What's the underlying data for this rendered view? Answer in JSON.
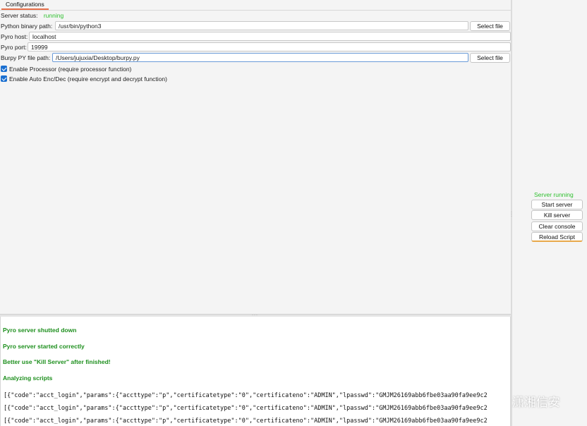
{
  "tabs": [
    {
      "label": "Configurations"
    }
  ],
  "config": {
    "server_status_label": "Server status:",
    "server_status_value": "running",
    "python_path_label": "Python binary path:",
    "python_path_value": "/usr/bin/python3",
    "pyro_host_label": "Pyro host:",
    "pyro_host_value": "localhost",
    "pyro_port_label": "Pyro port:",
    "pyro_port_value": "19999",
    "burpy_path_label": "Burpy PY file path:",
    "burpy_path_value": "/Users/jujuxia/Desktop/burpy.py",
    "select_file_label": "Select file",
    "enable_processor_label": "Enable Processor (require processor function)",
    "enable_processor_checked": true,
    "enable_autoenc_label": "Enable Auto Enc/Dec (require encrypt and decrypt function)",
    "enable_autoenc_checked": true
  },
  "right_panel": {
    "status": "Server running",
    "status_color": "#2fc02f",
    "start_server": "Start server",
    "kill_server": "Kill server",
    "clear_console": "Clear console",
    "reload_script": "Reload Script"
  },
  "console": {
    "messages": [
      "Pyro server shutted down",
      "Pyro server started correctly",
      "Better use \"Kill Server\" after finished!",
      "Analyzing scripts"
    ],
    "json_lines": [
      "[{\"code\":\"acct_login\",\"params\":{\"accttype\":\"p\",\"certificatetype\":\"0\",\"certificateno\":\"ADMIN\",\"lpasswd\":\"GMJM26169abb6fbe03aa90fa9ee9c2",
      "[{\"code\":\"acct_login\",\"params\":{\"accttype\":\"p\",\"certificatetype\":\"0\",\"certificateno\":\"ADMIN\",\"lpasswd\":\"GMJM26169abb6fbe03aa90fa9ee9c2",
      "[{\"code\":\"acct_login\",\"params\":{\"accttype\":\"p\",\"certificatetype\":\"0\",\"certificateno\":\"ADMIN\",\"lpasswd\":\"GMJM26169abb6fbe03aa90fa9ee9c2"
    ]
  },
  "watermark": {
    "text": "潇湘信安",
    "icon": "wechat-icon"
  },
  "colors": {
    "accent_tab": "#e8704a",
    "checkbox": "#1a6fd0",
    "console_green": "#1d8f1d"
  }
}
